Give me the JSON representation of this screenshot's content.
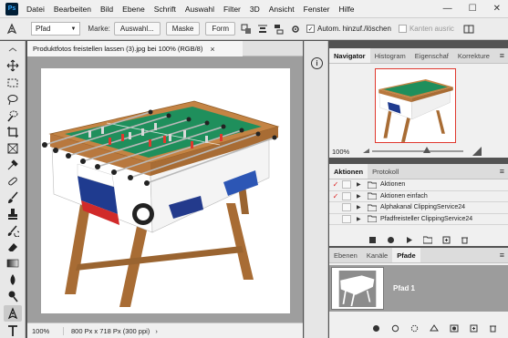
{
  "app": {
    "logo": "Ps"
  },
  "menubar": {
    "items": [
      "Datei",
      "Bearbeiten",
      "Bild",
      "Ebene",
      "Schrift",
      "Auswahl",
      "Filter",
      "3D",
      "Ansicht",
      "Fenster",
      "Hilfe"
    ],
    "win_controls": [
      "—",
      "☐",
      "✕"
    ]
  },
  "options": {
    "mode": "Pfad",
    "marke_label": "Marke:",
    "auswahl": "Auswahl...",
    "maske": "Maske",
    "form": "Form",
    "auto_label": "Autom. hinzuf./löschen",
    "auto_checked": "✓",
    "kanten_label": "Kanten ausric"
  },
  "document": {
    "tab_title": "Produktfotos freistellen lassen (3).jpg bei 100% (RGB/8)",
    "tab_close": "×",
    "zoom": "100%",
    "info": "800 Px x 718 Px (300 ppi)",
    "arrow": "›"
  },
  "navigator": {
    "tabs": [
      "Navigator",
      "Histogram",
      "Eigenschaf",
      "Korrekture"
    ],
    "zoom": "100%",
    "zoom_fraction": 0.6,
    "menu": "≡"
  },
  "actions": {
    "tabs": [
      "Aktionen",
      "Protokoll"
    ],
    "menu": "≡",
    "rows": [
      {
        "check": "✓",
        "name": "Aktionen"
      },
      {
        "check": "✓",
        "name": "Aktionen einfach"
      },
      {
        "check": "",
        "name": "Alphakanal ClippingService24"
      },
      {
        "check": "",
        "name": "Pfadfreisteller ClippingService24"
      }
    ]
  },
  "paths": {
    "tabs": [
      "Ebenen",
      "Kanäle",
      "Pfade"
    ],
    "menu": "≡",
    "items": [
      {
        "name": "Pfad 1"
      }
    ]
  },
  "colors": {
    "accent_red": "#e0382e",
    "table_wood": "#b8783e",
    "field_green": "#1f8f5c"
  }
}
